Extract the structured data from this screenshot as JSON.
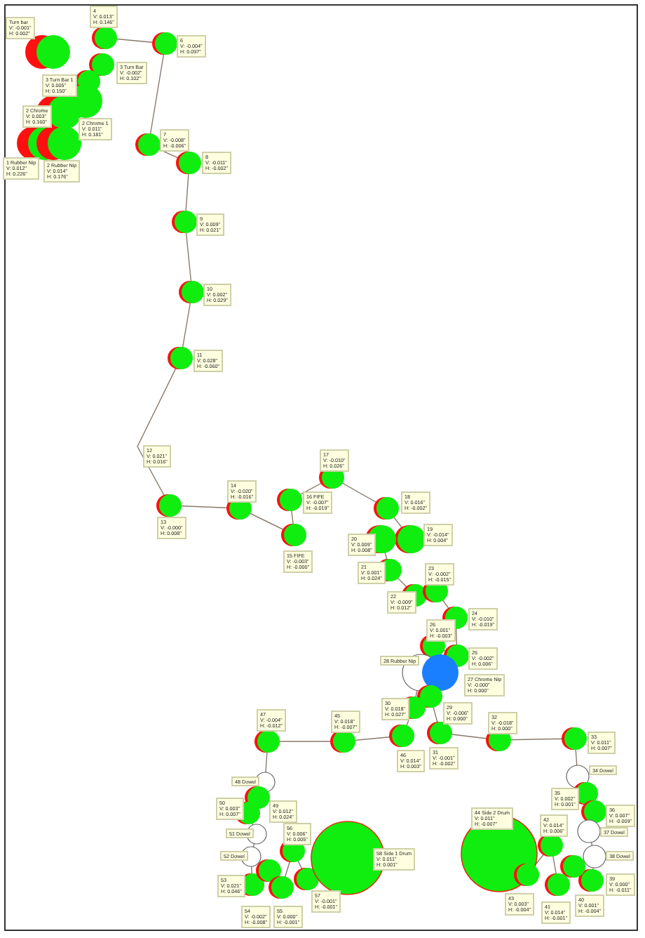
{
  "nodes": [
    {
      "kind": "roller",
      "label": [
        "Turn bar",
        "V: -0.001\"",
        "H: 0.002\""
      ]
    },
    {
      "kind": "roller",
      "label": [
        "4",
        "V: 0.013\"",
        "H: 0.146\""
      ]
    },
    {
      "kind": "roller",
      "label": [
        "3 Turn Bar",
        "V: -0.002\"",
        "H: 0.102\""
      ]
    },
    {
      "kind": "roller",
      "label": [
        "3 Turn Bar 1",
        "V: 0.005\"",
        "H: 0.150\""
      ]
    },
    {
      "kind": "roller",
      "label": [
        "2 Chrome 1",
        "V: 0.011\"",
        "H: 0.181\""
      ]
    },
    {
      "kind": "roller",
      "label": [
        "2 Chrome",
        "V: 0.003\"",
        "H: 0.160\""
      ]
    },
    {
      "kind": "roller",
      "label": [
        "1 Rubber Nip",
        "V: 0.012\"",
        "H: 0.226\""
      ]
    },
    {
      "kind": "roller",
      "label": [
        "2 Rubber Nip",
        "V: 0.014\"",
        "H: 0.176\""
      ]
    },
    {
      "kind": "roller",
      "label": [
        "6",
        "V: -0.004\"",
        "H: 0.097\""
      ]
    },
    {
      "kind": "roller",
      "label": [
        "7",
        "V: -0.008\"",
        "H: -0.006\""
      ]
    },
    {
      "kind": "roller",
      "label": [
        "8",
        "V: -0.011\"",
        "H: -0.002\""
      ]
    },
    {
      "kind": "roller",
      "label": [
        "9",
        "V: 0.009\"",
        "H: 0.021\""
      ]
    },
    {
      "kind": "roller",
      "label": [
        "10",
        "V: 0.002\"",
        "H: 0.029\""
      ]
    },
    {
      "kind": "roller",
      "label": [
        "11",
        "V: 0.028\"",
        "H: -0.060\""
      ]
    },
    {
      "kind": "bend",
      "label": [
        "12",
        "V: 0.021\"",
        "H: 0.016\""
      ]
    },
    {
      "kind": "roller",
      "label": [
        "13",
        "V: -0.000\"",
        "H: 0.008\""
      ]
    },
    {
      "kind": "roller",
      "label": [
        "14",
        "V: -0.020\"",
        "H: -0.016\""
      ]
    },
    {
      "kind": "roller",
      "label": [
        "16 FIFE",
        "V: -0.007\"",
        "H: -0.019\""
      ]
    },
    {
      "kind": "roller",
      "label": [
        "15 FIFE",
        "V: -0.003\"",
        "H: -0.000\""
      ]
    },
    {
      "kind": "roller",
      "label": [
        "17",
        "V: -0.010\"",
        "H: 0.026\""
      ]
    },
    {
      "kind": "roller",
      "label": [
        "18",
        "V: 0.016\"",
        "H: -0.002\""
      ]
    },
    {
      "kind": "roller",
      "label": [
        "19",
        "V: -0.014\"",
        "H: 0.004\""
      ]
    },
    {
      "kind": "roller",
      "label": [
        "20",
        "V: 0.009\"",
        "H: 0.008\""
      ]
    },
    {
      "kind": "roller",
      "label": [
        "21",
        "V: 0.001\"",
        "H: 0.024\""
      ]
    },
    {
      "kind": "roller",
      "label": [
        "22",
        "V: -0.009\"",
        "H: 0.012\""
      ]
    },
    {
      "kind": "roller",
      "label": [
        "23",
        "V: -0.002\"",
        "H: -0.015\""
      ]
    },
    {
      "kind": "roller",
      "label": [
        "24",
        "V: -0.010\"",
        "H: -0.019\""
      ]
    },
    {
      "kind": "roller",
      "label": [
        "25",
        "V: -0.002\"",
        "H: 0.006\""
      ]
    },
    {
      "kind": "roller",
      "label": [
        "26",
        "V: 0.001\"",
        "H: -0.003\""
      ]
    },
    {
      "kind": "idler",
      "label": [
        "28 Rubber Nip"
      ]
    },
    {
      "kind": "nip",
      "label": [
        "27 Chrome Nip",
        "V: -0.000\"",
        "H: 0.000\""
      ]
    },
    {
      "kind": "roller",
      "label": [
        "29",
        "V: -0.006\"",
        "H: 0.000\""
      ]
    },
    {
      "kind": "roller",
      "label": [
        "30",
        "V: 0.018\"",
        "H: 0.027\""
      ]
    },
    {
      "kind": "roller",
      "label": [
        "31",
        "V: -0.001\"",
        "H: -0.002\""
      ]
    },
    {
      "kind": "roller",
      "label": [
        "32",
        "V: -0.018\"",
        "H: 0.000\""
      ]
    },
    {
      "kind": "roller",
      "label": [
        "33",
        "V: 0.011\"",
        "H: 0.007\""
      ]
    },
    {
      "kind": "idler",
      "label": [
        "34 Dowel"
      ]
    },
    {
      "kind": "roller",
      "label": [
        "35",
        "V: 0.002\"",
        "H: 0.001\""
      ]
    },
    {
      "kind": "roller",
      "label": [
        "36",
        "V: 0.007\"",
        "H: -0.009\""
      ]
    },
    {
      "kind": "idler",
      "label": [
        "37 Dowel"
      ]
    },
    {
      "kind": "idler",
      "label": [
        "38 Dowel"
      ]
    },
    {
      "kind": "drum",
      "label": [
        "44 Side 2 Drum",
        "V: 0.011\"",
        "H: -0.007\""
      ]
    },
    {
      "kind": "roller",
      "label": [
        "42",
        "V: 0.014\"",
        "H: 0.006\""
      ]
    },
    {
      "kind": "roller",
      "label": [
        "39",
        "V: 0.000\"",
        "H: -0.011\""
      ]
    },
    {
      "kind": "roller",
      "label": [
        "40",
        "V: 0.001\"",
        "H: -0.004\""
      ]
    },
    {
      "kind": "roller",
      "label": [
        "41",
        "V: 0.014\"",
        "H: -0.001\""
      ]
    },
    {
      "kind": "roller",
      "label": [
        "43",
        "V: 0.003\"",
        "H: -0.004\""
      ]
    },
    {
      "kind": "roller",
      "label": [
        "45",
        "V: 0.018\"",
        "H: -0.007\""
      ]
    },
    {
      "kind": "roller",
      "label": [
        "46",
        "V: 0.014\"",
        "H: 0.003\""
      ]
    },
    {
      "kind": "roller",
      "label": [
        "47",
        "V: -0.004\"",
        "H: -0.012\""
      ]
    },
    {
      "kind": "idler",
      "label": [
        "48 Dowel"
      ]
    },
    {
      "kind": "roller",
      "label": [
        "49",
        "V: 0.012\"",
        "H: 0.024\""
      ]
    },
    {
      "kind": "roller",
      "label": [
        "50",
        "V: 0.003\"",
        "H: 0.007\""
      ]
    },
    {
      "kind": "idler",
      "label": [
        "51 Dowel"
      ]
    },
    {
      "kind": "roller",
      "label": [
        "56",
        "V: 0.006\"",
        "H: 0.005\""
      ]
    },
    {
      "kind": "idler",
      "label": [
        "52 Dowel"
      ]
    },
    {
      "kind": "roller",
      "label": [
        "53",
        "V: 0.021\"",
        "H: 0.046\""
      ]
    },
    {
      "kind": "roller",
      "label": [
        "54",
        "V: -0.002\"",
        "H: -0.008\""
      ]
    },
    {
      "kind": "roller",
      "label": [
        "55",
        "V: 0.000\"",
        "H: -0.001\""
      ]
    },
    {
      "kind": "roller",
      "label": [
        "57",
        "V: -0.001\"",
        "H: -0.001\""
      ]
    },
    {
      "kind": "drum",
      "label": [
        "58 Side 1 Drum",
        "V: 0.011\"",
        "H: 0.001\""
      ]
    }
  ]
}
